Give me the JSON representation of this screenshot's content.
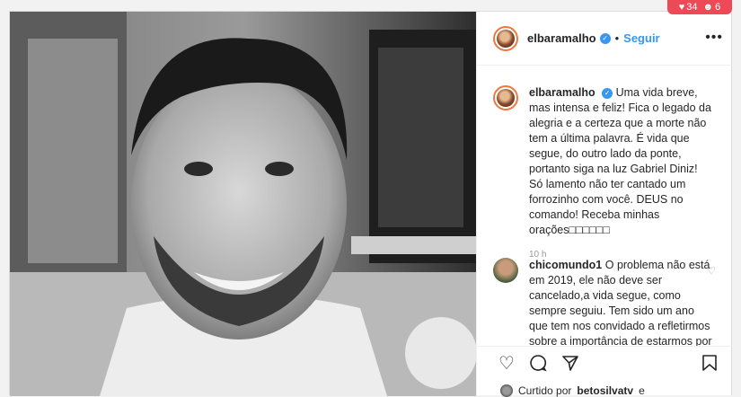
{
  "notifications": {
    "likes": "34",
    "followers": "6"
  },
  "post": {
    "username": "elbaramalho",
    "follow_label": "Seguir",
    "dot": "•",
    "more": "•••",
    "caption": {
      "username": "elbaramalho",
      "text": "Uma vida breve, mas intensa e feliz! Fica o legado da alegria e a certeza que a morte não tem a última palavra. É vida que segue, do outro lado da ponte, portanto siga na luz Gabriel Diniz! Só lamento não ter cantado um forrozinho com você. DEUS no comando! Receba minhas orações□□□□□□",
      "time": "10 h"
    },
    "comment": {
      "username": "chicomundo1",
      "text": "O problema não está em 2019, ele não deve ser cancelado,a vida segue, como sempre seguiu. Tem sido um ano que tem nos convidado a refletirmos  sobre a importância de estarmos por"
    },
    "liked_by": {
      "prefix": "Curtido por",
      "user": "betosilvatv",
      "suffix": "e"
    }
  },
  "icons": [
    "heart-icon",
    "comment-icon",
    "share-icon",
    "bookmark-icon",
    "verified-icon",
    "person-icon",
    "more-icon"
  ],
  "colors": {
    "accent": "#3897f0",
    "notif": "#ed4956"
  }
}
